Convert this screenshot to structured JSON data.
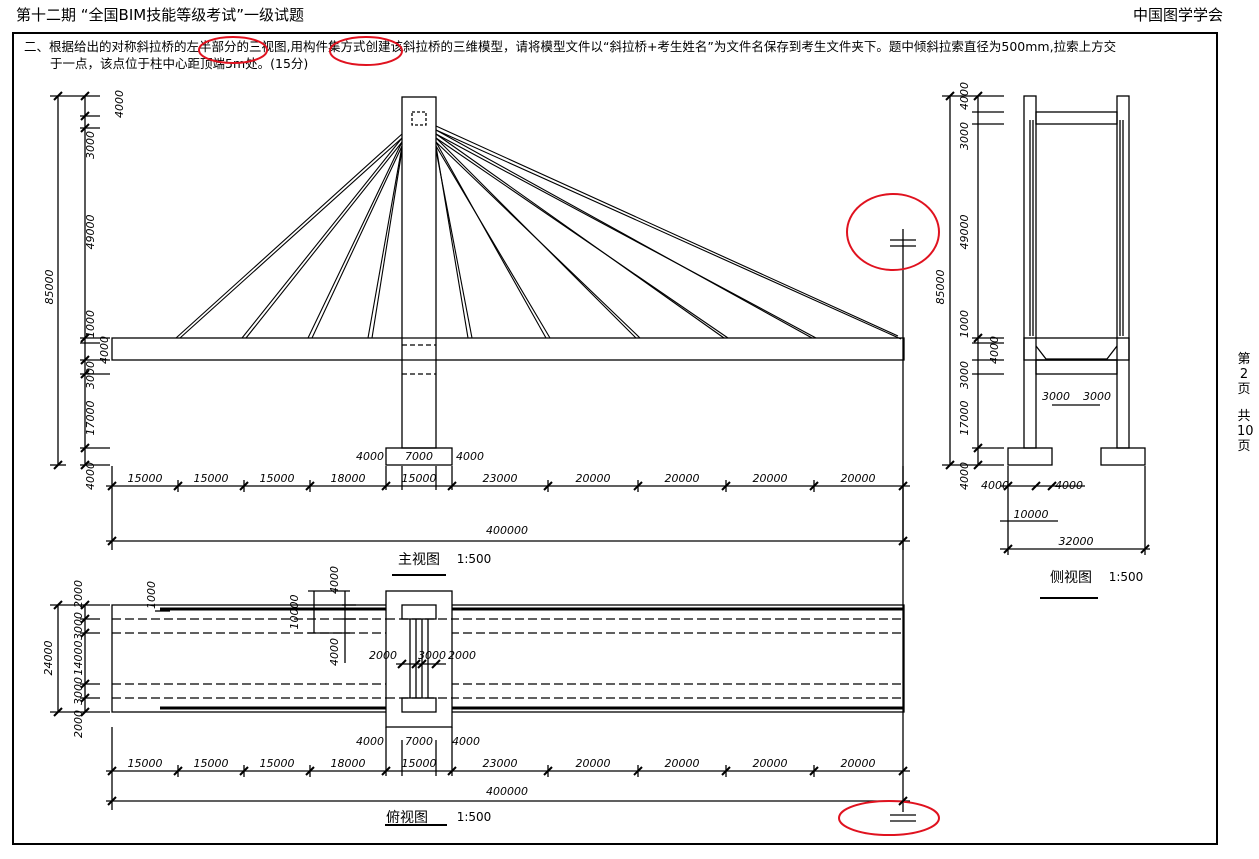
{
  "header": {
    "left": "第十二期 “全国BIM技能等级考试”一级试题",
    "right": "中国图学学会"
  },
  "question": {
    "line1": "二、根据给出的对称斜拉桥的左半部分的三视图,用构件集方式创建该斜拉桥的三维模型，请将模型文件以“斜拉桥+考生姓名”为文件名保存到考生文件夹下。题中倾斜拉索直径为500mm,拉索上方交",
    "line2": "于一点，该点位于柱中心距顶端5m处。(15分)"
  },
  "page_indicator": [
    "第",
    "2",
    "页",
    "",
    "共",
    "10",
    "页"
  ],
  "views": {
    "front": {
      "name": "主视图",
      "scale": "1:500"
    },
    "side": {
      "name": "侧视图",
      "scale": "1:500"
    },
    "top": {
      "name": "俯视图",
      "scale": "1:500"
    }
  },
  "front_dims": {
    "vertical": [
      "4000",
      "3000",
      "49000",
      "85000",
      "1000",
      "4000",
      "3000",
      "17000",
      "4000"
    ],
    "pier_base": [
      "4000",
      "7000",
      "4000"
    ],
    "spans": [
      "15000",
      "15000",
      "15000",
      "18000",
      "15000",
      "23000",
      "20000",
      "20000",
      "20000",
      "20000"
    ],
    "total": "400000"
  },
  "side_dims": {
    "vertical": [
      "4000",
      "3000",
      "49000",
      "85000",
      "1000",
      "4000",
      "3000",
      "17000",
      "4000"
    ],
    "leg_gap": [
      "3000",
      "3000"
    ],
    "base": [
      "4000",
      "4000",
      "10000"
    ],
    "total": "32000"
  },
  "top_dims": {
    "vertical": [
      "2000",
      "3000",
      "14000",
      "3000",
      "2000",
      "24000"
    ],
    "cable": "1000",
    "tower": [
      "10000",
      "4000",
      "4000"
    ],
    "tower_gap": [
      "2000",
      "3000",
      "2000"
    ],
    "pier_base": [
      "4000",
      "7000",
      "4000"
    ],
    "spans": [
      "15000",
      "15000",
      "15000",
      "18000",
      "15000",
      "23000",
      "20000",
      "20000",
      "20000",
      "20000"
    ],
    "total": "400000"
  },
  "colors": {
    "ink": "#000000",
    "highlight": "#e0121f"
  }
}
